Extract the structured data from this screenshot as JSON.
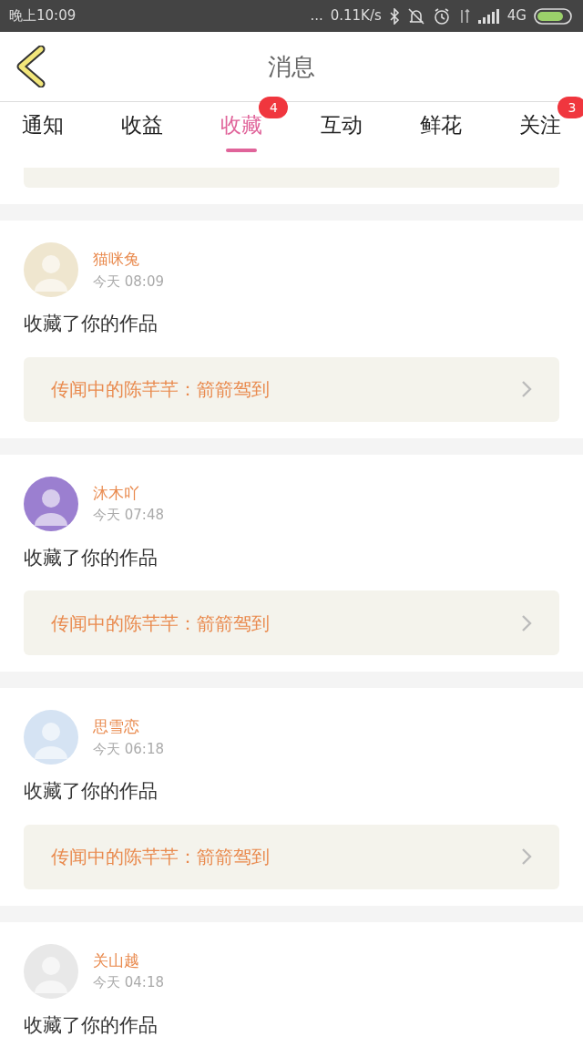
{
  "status_bar": {
    "time": "晚上10:09",
    "dots": "...",
    "speed": "0.11K/s",
    "network": "4G"
  },
  "header": {
    "title": "消息"
  },
  "tabs": [
    {
      "label": "通知",
      "selected": false
    },
    {
      "label": "收益",
      "selected": false
    },
    {
      "label": "收藏",
      "selected": true,
      "badge": "4"
    },
    {
      "label": "互动",
      "selected": false
    },
    {
      "label": "鲜花",
      "selected": false
    },
    {
      "label": "关注",
      "selected": false,
      "badge": "3"
    }
  ],
  "messages": [
    {
      "kind": "partial"
    },
    {
      "kind": "full",
      "user": "猫咪兔",
      "time": "今天 08:09",
      "action": "收藏了你的作品",
      "work": "传闻中的陈芊芊：箭箭驾到"
    },
    {
      "kind": "full",
      "user": "沐木吖",
      "time": "今天 07:48",
      "action": "收藏了你的作品",
      "work": "传闻中的陈芊芊：箭箭驾到"
    },
    {
      "kind": "full",
      "user": "思雪恋",
      "time": "今天 06:18",
      "action": "收藏了你的作品",
      "work": "传闻中的陈芊芊：箭箭驾到"
    },
    {
      "kind": "cut",
      "user": "关山越",
      "time": "今天 04:18",
      "action": "收藏了你的作品"
    }
  ]
}
